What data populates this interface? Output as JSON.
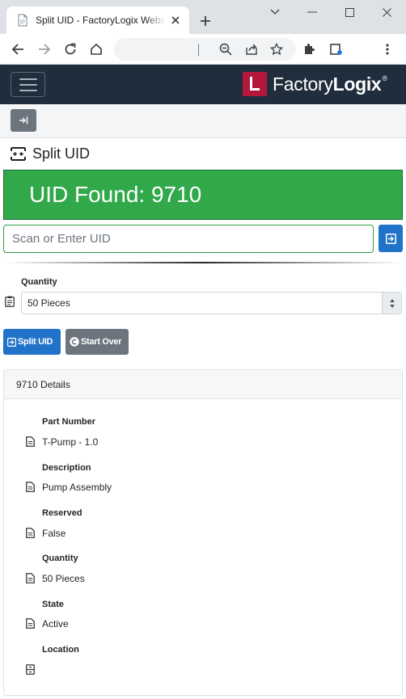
{
  "browser": {
    "tab_title": "Split UID - FactoryLogix Website",
    "new_tab_icon": "plus-icon",
    "window_controls": [
      "minimize-icon",
      "maximize-icon",
      "close-icon"
    ],
    "nav_icons": [
      "back-arrow-icon",
      "forward-arrow-icon",
      "reload-icon",
      "home-icon"
    ],
    "omnibox_icons": [
      "zoom-icon",
      "share-icon",
      "star-icon"
    ],
    "extension_icons": [
      "extensions-puzzle-icon",
      "sidepanel-icon",
      "kebab-menu-icon"
    ]
  },
  "app": {
    "brand_name_part1": "Factory",
    "brand_name_part2": "Logix",
    "brand_registered": "®",
    "brand_color": "#b3183b",
    "navbar_color": "#1f2d3d"
  },
  "page": {
    "title": "Split UID",
    "found_message": "UID Found: 9710",
    "found_color": "#31a84a",
    "scan_placeholder": "Scan or Enter UID",
    "scan_value": "",
    "quantity_label": "Quantity",
    "quantity_value": "50 Pieces",
    "split_button": "Split UID",
    "start_over_button": "Start Over",
    "primary_color": "#2173c9"
  },
  "details": {
    "header": "9710 Details",
    "fields": [
      {
        "label": "Part Number",
        "value": "T-Pump - 1.0",
        "icon": "document-icon"
      },
      {
        "label": "Description",
        "value": "Pump Assembly",
        "icon": "document-icon"
      },
      {
        "label": "Reserved",
        "value": "False",
        "icon": "document-icon"
      },
      {
        "label": "Quantity",
        "value": "50 Pieces",
        "icon": "document-icon"
      },
      {
        "label": "State",
        "value": "Active",
        "icon": "document-icon"
      },
      {
        "label": "Location",
        "value": "",
        "icon": "cabinet-icon"
      }
    ]
  }
}
